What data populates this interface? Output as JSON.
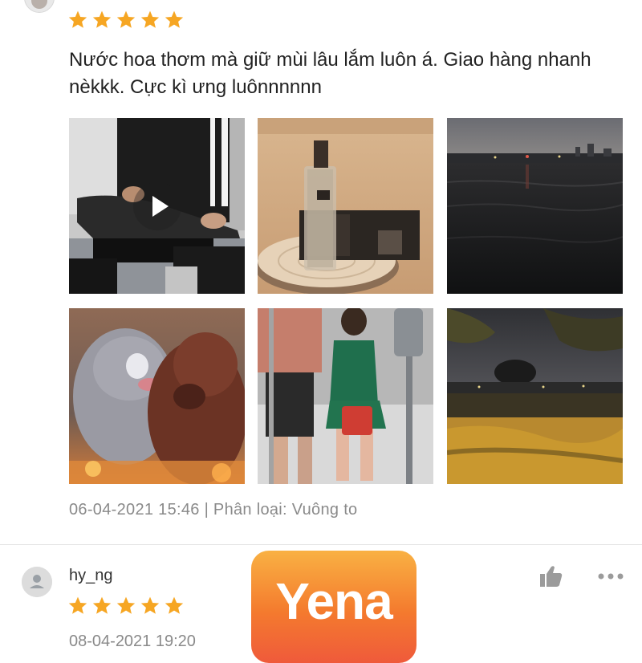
{
  "review1": {
    "rating": 5,
    "text": "Nước hoa thơm mà giữ mùi lâu lắm luôn á. Giao hàng nhanh nèkkk. Cực kì ưng luônnnnnn",
    "timestamp": "06-04-2021 15:46",
    "variation": "| Phân loại: Vuông to",
    "media": [
      {
        "type": "video",
        "subject": "person sitting on motorbike"
      },
      {
        "type": "image",
        "subject": "perfume bottle on wooden slab"
      },
      {
        "type": "image",
        "subject": "lake at dusk with city skyline"
      },
      {
        "type": "image",
        "subject": "animated creatures"
      },
      {
        "type": "image",
        "subject": "people walking on street"
      },
      {
        "type": "image",
        "subject": "lake at night with trees"
      }
    ]
  },
  "review2": {
    "username": "hy_ng",
    "rating": 5,
    "timestamp_partial": "08-04-2021 19:20"
  },
  "icons": {
    "star": "star-icon",
    "like": "thumbs-up-icon",
    "more": "more-dots-icon",
    "avatar": "user-avatar-icon",
    "play": "play-icon"
  },
  "colors": {
    "star": "#f6a623",
    "meta_text": "#8a8a8a",
    "icon_gray": "#9b9b9b"
  },
  "watermark": {
    "text": "Yena"
  }
}
